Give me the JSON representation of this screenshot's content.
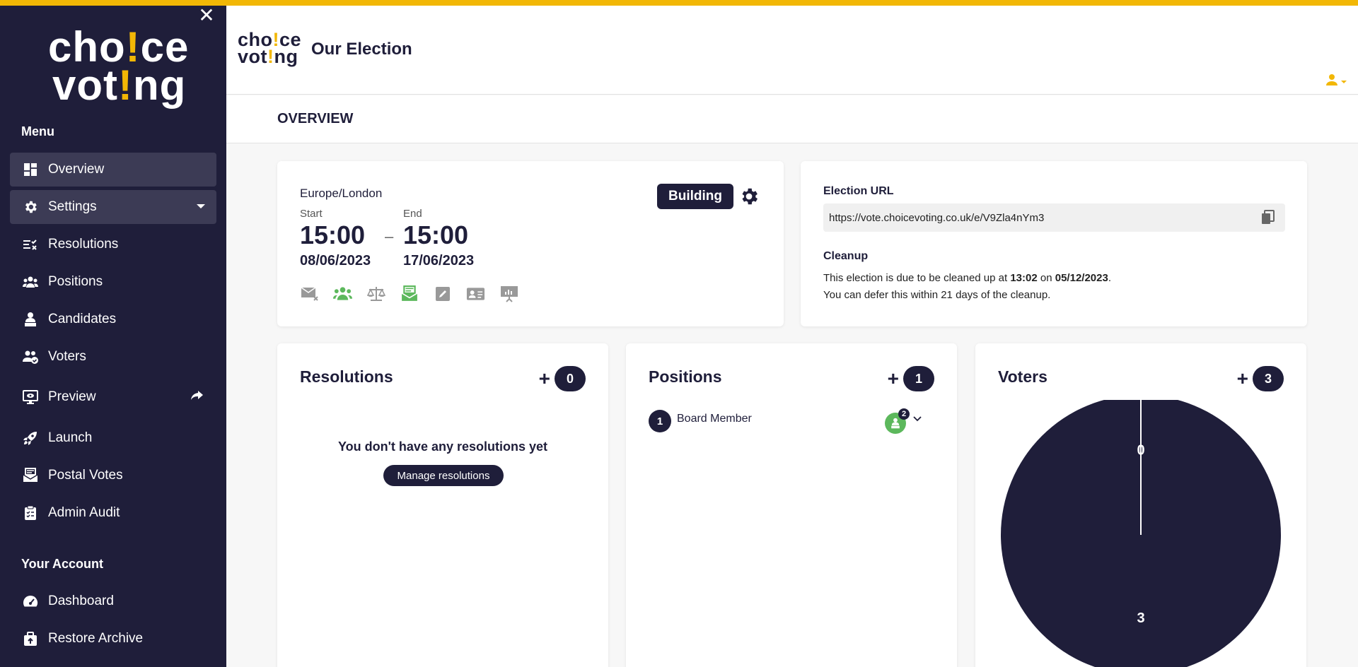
{
  "sidebar": {
    "logo_line1_a": "cho",
    "logo_line1_ex": "!",
    "logo_line1_b": "ce",
    "logo_line2_a": "vot",
    "logo_line2_ex": "!",
    "logo_line2_b": "ng",
    "close": "✕",
    "menu_title": "Menu",
    "items": [
      {
        "label": "Overview",
        "icon": "dashboard-grid-icon"
      },
      {
        "label": "Settings",
        "icon": "gear-icon"
      },
      {
        "label": "Resolutions",
        "icon": "list-check-icon"
      },
      {
        "label": "Positions",
        "icon": "group-icon"
      },
      {
        "label": "Candidates",
        "icon": "person-podium-icon"
      },
      {
        "label": "Voters",
        "icon": "voters-icon"
      },
      {
        "label": "Preview",
        "icon": "monitor-eye-icon"
      },
      {
        "label": "Launch",
        "icon": "rocket-icon"
      },
      {
        "label": "Postal Votes",
        "icon": "mail-stack-icon"
      },
      {
        "label": "Admin Audit",
        "icon": "clipboard-icon"
      }
    ],
    "account_title": "Your Account",
    "account_items": [
      {
        "label": "Dashboard",
        "icon": "gauge-icon"
      },
      {
        "label": "Restore Archive",
        "icon": "archive-upload-icon"
      }
    ]
  },
  "header": {
    "logo_line1_a": "cho",
    "logo_line1_ex": "!",
    "logo_line1_b": "ce",
    "logo_line2_a": "vot",
    "logo_line2_ex": "!",
    "logo_line2_b": "ng",
    "title": "Our Election"
  },
  "subheader": {
    "title": "OVERVIEW"
  },
  "schedule": {
    "timezone": "Europe/London",
    "start_label": "Start",
    "end_label": "End",
    "start_time": "15:00",
    "end_time": "15:00",
    "separator": "–",
    "start_date": "08/06/2023",
    "end_date": "17/06/2023",
    "status": "Building",
    "feature_icons": [
      "mail-off-icon",
      "voters-check-icon",
      "scales-icon",
      "postal-icon",
      "edit-icon",
      "id-card-icon",
      "presentation-icon"
    ]
  },
  "election": {
    "url_label": "Election URL",
    "url": "https://vote.choicevoting.co.uk/e/V9Zla4nYm3",
    "cleanup_label": "Cleanup",
    "cleanup_text_1": "This election is due to be cleaned up at ",
    "cleanup_time": "13:02",
    "cleanup_text_2": " on ",
    "cleanup_date": "05/12/2023",
    "cleanup_text_3": ".",
    "cleanup_text_4": "You can defer this within 21 days of the cleanup."
  },
  "resolutions": {
    "title": "Resolutions",
    "plus": "+",
    "count": "0",
    "empty_text": "You don't have any resolutions yet",
    "manage_label": "Manage resolutions"
  },
  "positions": {
    "title": "Positions",
    "plus": "+",
    "count": "1",
    "items": [
      {
        "number": "1",
        "name": "Board Member",
        "candidates": "2"
      }
    ]
  },
  "voters": {
    "title": "Voters",
    "plus": "+",
    "count": "3"
  },
  "chart_data": {
    "type": "pie",
    "slices": [
      {
        "label": "0",
        "value": 0
      },
      {
        "label": "3",
        "value": 3
      }
    ],
    "colors": [
      "#1f1e3a",
      "#1f1e3a"
    ]
  },
  "colors": {
    "sidebar_bg": "#1f1e3a",
    "accent": "#f2b705",
    "success": "#5cb85c"
  }
}
